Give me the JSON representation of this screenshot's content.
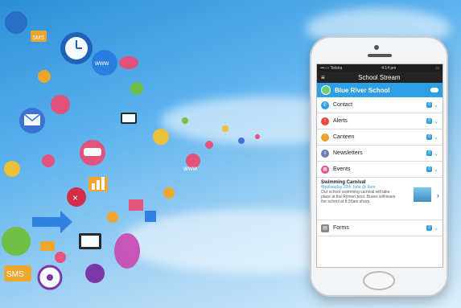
{
  "phone": {
    "status": {
      "carrier": "•••○○ Telstra",
      "time": "4:14 pm",
      "battery": "▭"
    },
    "nav_title": "School Stream",
    "school_name": "Blue River School",
    "menu": [
      {
        "label": "Contact",
        "icon": "contact-icon",
        "color": "#2f9ee4",
        "glyph": "✆"
      },
      {
        "label": "Alerts",
        "icon": "alert-icon",
        "color": "#e8473d",
        "glyph": "!"
      },
      {
        "label": "Canteen",
        "icon": "canteen-icon",
        "color": "#f2a01c",
        "glyph": "🍴"
      },
      {
        "label": "Newsletters",
        "icon": "newsletter-icon",
        "color": "#6b7bb0",
        "glyph": "≡"
      },
      {
        "label": "Events",
        "icon": "events-icon",
        "color": "#e24a8a",
        "glyph": "▦"
      }
    ],
    "event": {
      "title": "Swimming Carnival",
      "date": "Wednesday 20th June @ 9am",
      "desc": "Our school swimming carnival will take place at the Rymon pool. Buses will leave the school at 8:30am sharp."
    },
    "forms_label": "Forms"
  },
  "colors": {
    "accent": "#2f9ee4"
  }
}
